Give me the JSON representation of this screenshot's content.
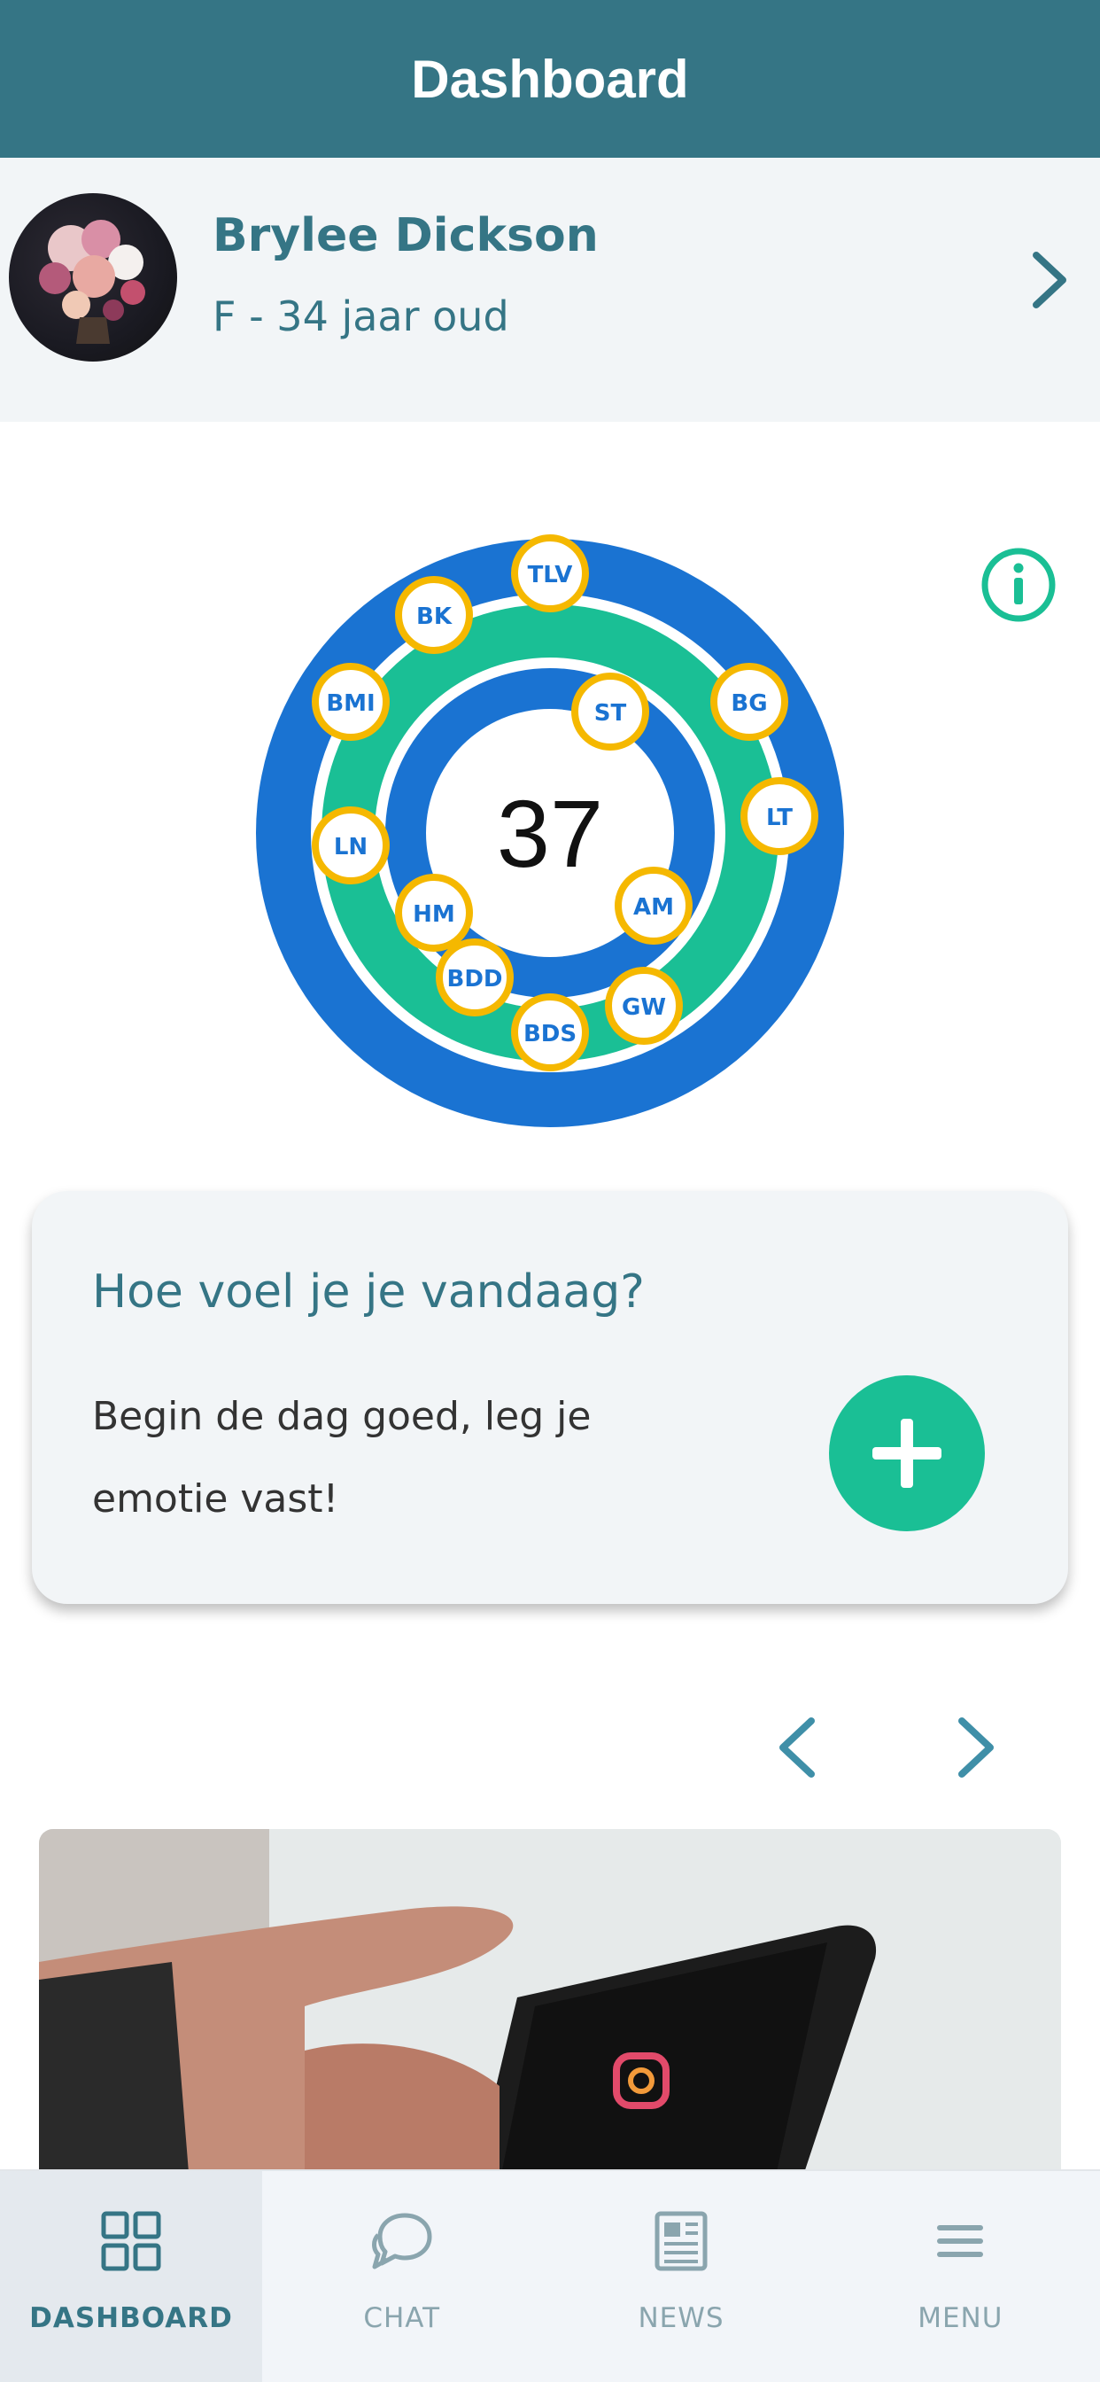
{
  "header": {
    "title": "Dashboard"
  },
  "profile": {
    "name": "Brylee Dickson",
    "subtitle": "F - 34 jaar oud"
  },
  "score": {
    "value": "37",
    "badges": [
      "TLV",
      "BK",
      "BMI",
      "BG",
      "ST",
      "LT",
      "LN",
      "AM",
      "HM",
      "BDD",
      "GW",
      "BDS"
    ]
  },
  "emotion_card": {
    "title": "Hoe voel je je vandaag?",
    "text": "Begin de dag goed, leg je emotie vast!"
  },
  "colors": {
    "header": "#357585",
    "ring_blue": "#1a73d2",
    "ring_green": "#1abf95",
    "badge_border": "#f5b800",
    "accent": "#1abf95"
  },
  "tabs": [
    {
      "label": "DASHBOARD",
      "icon": "grid-icon",
      "active": true
    },
    {
      "label": "CHAT",
      "icon": "chat-icon",
      "active": false
    },
    {
      "label": "NEWS",
      "icon": "newspaper-icon",
      "active": false
    },
    {
      "label": "MENU",
      "icon": "hamburger-icon",
      "active": false
    }
  ]
}
